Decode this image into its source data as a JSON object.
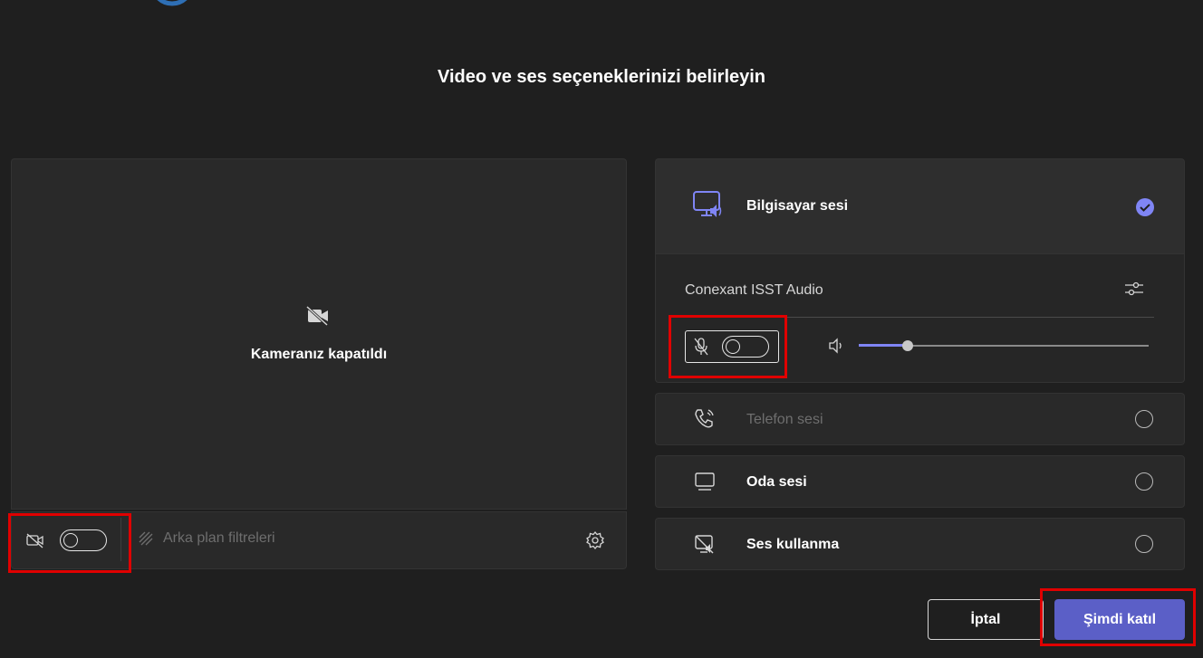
{
  "header": {
    "title": "Video ve ses seçeneklerinizi belirleyin"
  },
  "video": {
    "camera_off_label": "Kameranız kapatıldı",
    "background_filters_label": "Arka plan filtreleri",
    "camera_toggle_on": false
  },
  "audio": {
    "options": [
      {
        "label": "Bilgisayar sesi",
        "selected": true,
        "icon": "computer-audio-icon"
      },
      {
        "label": "Telefon sesi",
        "selected": false,
        "icon": "phone-audio-icon"
      },
      {
        "label": "Oda sesi",
        "selected": false,
        "icon": "room-audio-icon"
      },
      {
        "label": "Ses kullanma",
        "selected": false,
        "icon": "no-audio-icon"
      }
    ],
    "device_name": "Conexant ISST Audio",
    "mic_toggle_on": false,
    "speaker_volume_fraction": 0.17
  },
  "actions": {
    "cancel_label": "İptal",
    "join_label": "Şimdi katıl"
  },
  "colors": {
    "accent": "#7f85f5",
    "join_bg": "#5b5fc7",
    "highlight": "#e00000"
  }
}
